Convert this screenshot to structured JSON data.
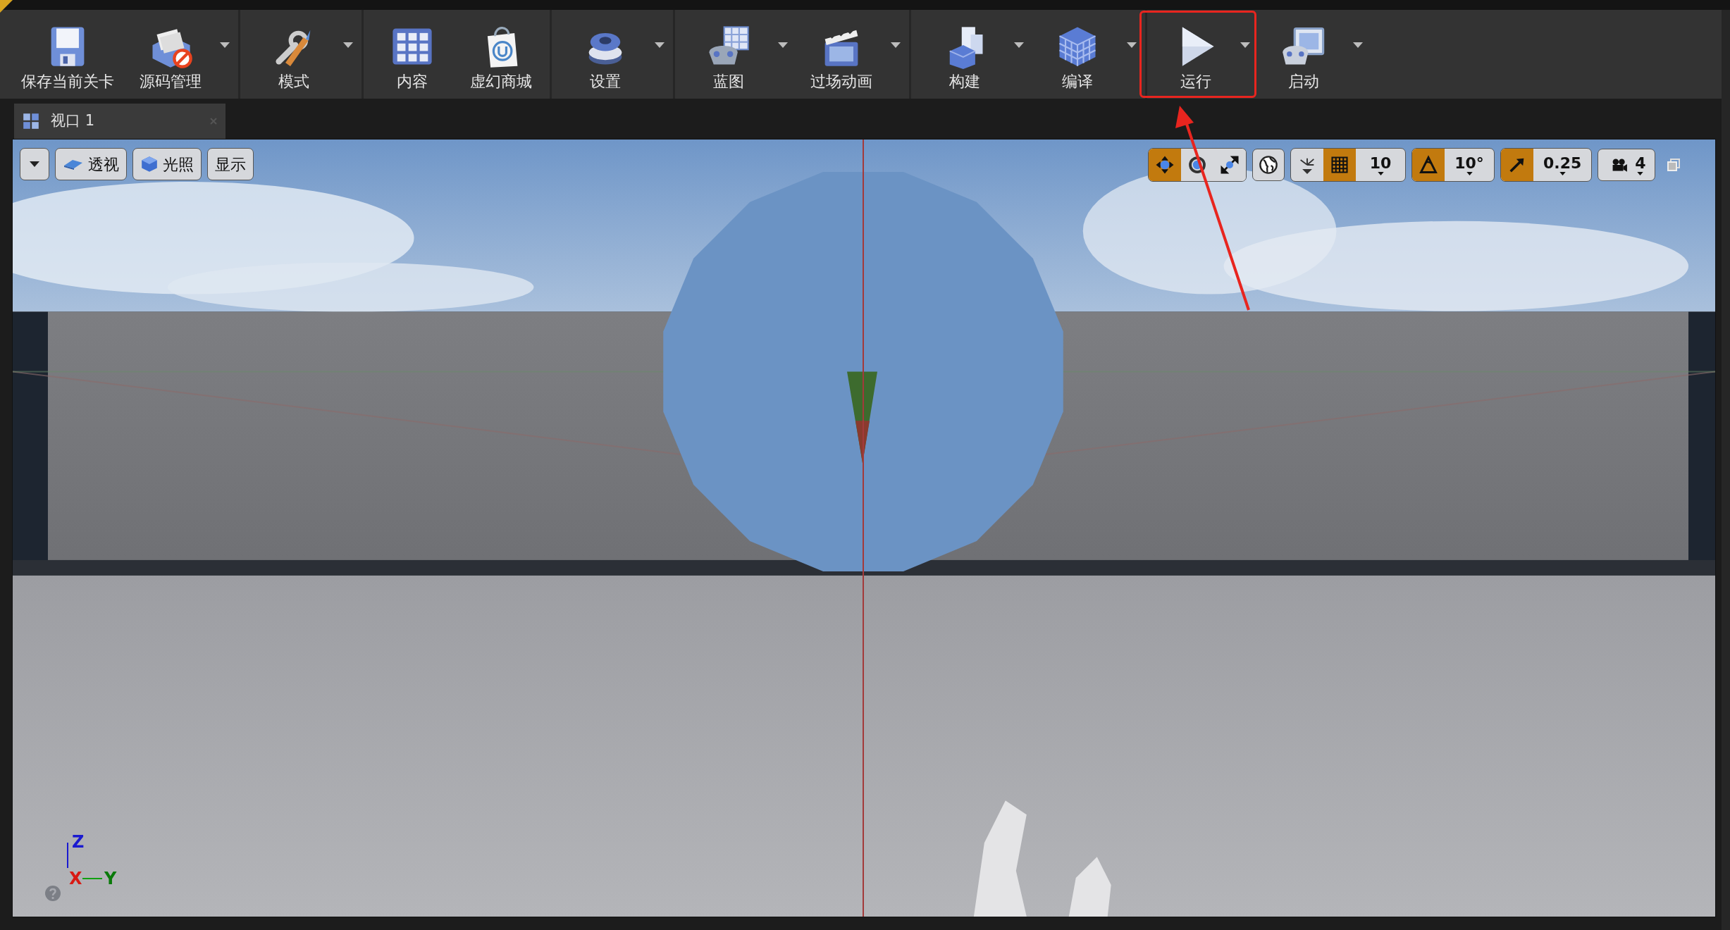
{
  "toolbar": {
    "groups": [
      {
        "items": [
          {
            "kind": "save",
            "label": "保存当前关卡",
            "dropdown": false,
            "highlighted": false
          },
          {
            "kind": "source",
            "label": "源码管理",
            "dropdown": true,
            "highlighted": false
          }
        ]
      },
      {
        "items": [
          {
            "kind": "modes",
            "label": "模式",
            "dropdown": true,
            "highlighted": false
          }
        ]
      },
      {
        "items": [
          {
            "kind": "content",
            "label": "内容",
            "dropdown": false,
            "highlighted": false
          },
          {
            "kind": "market",
            "label": "虚幻商城",
            "dropdown": false,
            "highlighted": false
          }
        ]
      },
      {
        "items": [
          {
            "kind": "settings",
            "label": "设置",
            "dropdown": true,
            "highlighted": false
          }
        ]
      },
      {
        "items": [
          {
            "kind": "blueprint",
            "label": "蓝图",
            "dropdown": true,
            "highlighted": false
          },
          {
            "kind": "cinematics",
            "label": "过场动画",
            "dropdown": true,
            "highlighted": false
          }
        ]
      },
      {
        "items": [
          {
            "kind": "build",
            "label": "构建",
            "dropdown": true,
            "highlighted": false
          },
          {
            "kind": "compile",
            "label": "编译",
            "dropdown": true,
            "highlighted": false
          }
        ]
      },
      {
        "items": [
          {
            "kind": "play",
            "label": "运行",
            "dropdown": true,
            "highlighted": true
          },
          {
            "kind": "launch",
            "label": "启动",
            "dropdown": true,
            "highlighted": false
          }
        ]
      }
    ]
  },
  "tabs": [
    {
      "label": "视口 1",
      "selected": true
    }
  ],
  "viewport_toolbar": {
    "left_buttons": [
      {
        "kind": "perspective",
        "label": "透视"
      },
      {
        "kind": "lighting",
        "label": "光照"
      },
      {
        "kind": "show",
        "label": "显示"
      }
    ],
    "transform_modes": [
      {
        "kind": "translate",
        "selected": true
      },
      {
        "kind": "rotate",
        "selected": false
      },
      {
        "kind": "scale",
        "selected": false
      }
    ],
    "snaps": [
      {
        "kind": "grid",
        "value": "10",
        "on": true
      },
      {
        "kind": "rotation",
        "value": "10°",
        "on": true
      },
      {
        "kind": "scale",
        "value": "0.25",
        "on": true
      }
    ],
    "camera_speed": "4"
  },
  "axis_gizmo": {
    "z": "Z",
    "x": "X",
    "y": "Y"
  }
}
